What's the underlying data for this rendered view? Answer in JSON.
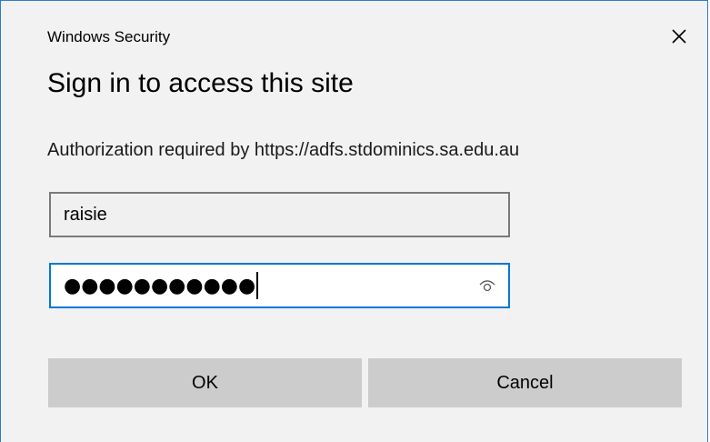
{
  "dialog": {
    "caption": "Windows Security",
    "close_icon": "close-icon",
    "heading": "Sign in to access this site",
    "message": "Authorization required by https://adfs.stdominics.sa.edu.au"
  },
  "username": {
    "value": "raisie"
  },
  "password": {
    "masked_value": "●●●●●●●●●●●",
    "reveal_icon": "eye-icon"
  },
  "buttons": {
    "ok_label": "OK",
    "cancel_label": "Cancel"
  },
  "colors": {
    "dialog_bg": "#f2f2f2",
    "accent_border": "#0078d7",
    "button_bg": "#cccccc"
  }
}
